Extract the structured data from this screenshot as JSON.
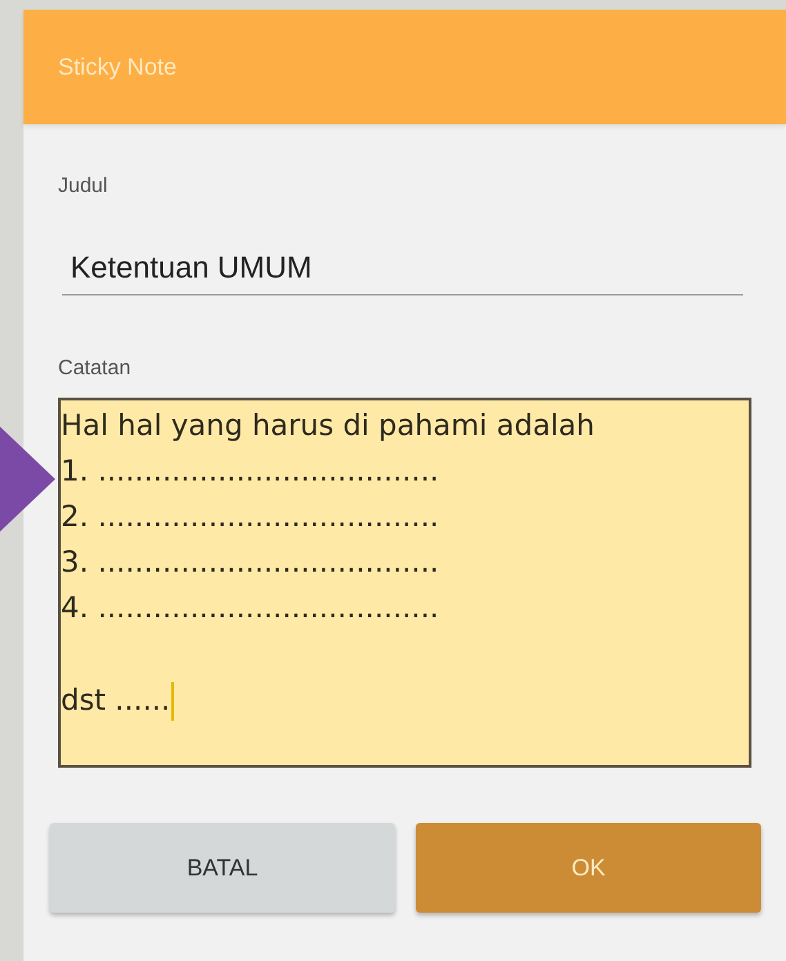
{
  "dialog": {
    "title": "Sticky Note"
  },
  "title_field": {
    "label": "Judul",
    "value": "Ketentuan UMUM"
  },
  "note_field": {
    "label": "Catatan",
    "lines": [
      "Hal hal yang harus di pahami adalah",
      "1. .....................................",
      "2. .....................................",
      "3. .....................................",
      "4. ....................................."
    ],
    "last_line": "dst ......",
    "cursor": true
  },
  "buttons": [
    {
      "label": "BATAL",
      "kind": "secondary"
    },
    {
      "label": "OK",
      "kind": "primary"
    }
  ]
}
